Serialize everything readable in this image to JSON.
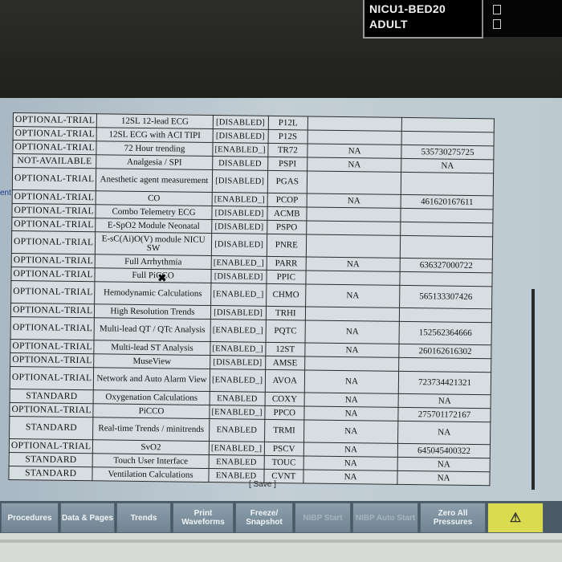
{
  "header": {
    "bed_name": "NICU1-BED20",
    "patient_type": "ADULT"
  },
  "edge_text": "ent",
  "options": [
    {
      "status": "OPTIONAL-TRIAL",
      "feature": "12SL 12-lead ECG",
      "state": "[DISABLED]",
      "code": "P12L",
      "license": "",
      "key": ""
    },
    {
      "status": "OPTIONAL-TRIAL",
      "feature": "12SL ECG with ACI TIPI",
      "state": "[DISABLED]",
      "code": "P12S",
      "license": "",
      "key": ""
    },
    {
      "status": "OPTIONAL-TRIAL",
      "feature": "72 Hour trending",
      "state": "[ENABLED_]",
      "code": "TR72",
      "license": "NA",
      "key": "535730275725"
    },
    {
      "status": "NOT-AVAILABLE",
      "feature": "Analgesia / SPI",
      "state": "DISABLED",
      "code": "PSPI",
      "license": "NA",
      "key": "NA"
    },
    {
      "status": "OPTIONAL-TRIAL",
      "feature": "Anesthetic agent measurement",
      "state": "[DISABLED]",
      "code": "PGAS",
      "license": "",
      "key": "",
      "tall": true
    },
    {
      "status": "OPTIONAL-TRIAL",
      "feature": "CO",
      "state": "[ENABLED_]",
      "code": "PCOP",
      "license": "NA",
      "key": "461620167611"
    },
    {
      "status": "OPTIONAL-TRIAL",
      "feature": "Combo Telemetry ECG",
      "state": "[DISABLED]",
      "code": "ACMB",
      "license": "",
      "key": ""
    },
    {
      "status": "OPTIONAL-TRIAL",
      "feature": "E-SpO2 Module Neonatal",
      "state": "[DISABLED]",
      "code": "PSPO",
      "license": "",
      "key": ""
    },
    {
      "status": "OPTIONAL-TRIAL",
      "feature": "E-sC(Ai)O(V) module NICU SW",
      "state": "[DISABLED]",
      "code": "PNRE",
      "license": "",
      "key": "",
      "tall": true
    },
    {
      "status": "OPTIONAL-TRIAL",
      "feature": "Full Arrhythmia",
      "state": "[ENABLED_]",
      "code": "PARR",
      "license": "NA",
      "key": "636327000722"
    },
    {
      "status": "OPTIONAL-TRIAL",
      "feature": "Full PiCCO",
      "state": "[DISABLED]",
      "code": "PPIC",
      "license": "",
      "key": ""
    },
    {
      "status": "OPTIONAL-TRIAL",
      "feature": "Hemodynamic Calculations",
      "state": "[ENABLED_]",
      "code": "CHMO",
      "license": "NA",
      "key": "565133307426",
      "tall": true
    },
    {
      "status": "OPTIONAL-TRIAL",
      "feature": "High Resolution Trends",
      "state": "[DISABLED]",
      "code": "TRHI",
      "license": "",
      "key": ""
    },
    {
      "status": "OPTIONAL-TRIAL",
      "feature": "Multi-lead QT / QTc Analysis",
      "state": "[ENABLED_]",
      "code": "PQTC",
      "license": "NA",
      "key": "152562364666",
      "tall": true
    },
    {
      "status": "OPTIONAL-TRIAL",
      "feature": "Multi-lead ST Analysis",
      "state": "[ENABLED_]",
      "code": "12ST",
      "license": "NA",
      "key": "260162616302"
    },
    {
      "status": "OPTIONAL-TRIAL",
      "feature": "MuseView",
      "state": "[DISABLED]",
      "code": "AMSE",
      "license": "",
      "key": ""
    },
    {
      "status": "OPTIONAL-TRIAL",
      "feature": "Network and Auto Alarm View",
      "state": "[ENABLED_]",
      "code": "AVOA",
      "license": "NA",
      "key": "723734421321",
      "tall": true
    },
    {
      "status": "STANDARD",
      "feature": "Oxygenation Calculations",
      "state": "ENABLED",
      "code": "COXY",
      "license": "NA",
      "key": "NA"
    },
    {
      "status": "OPTIONAL-TRIAL",
      "feature": "PiCCO",
      "state": "[ENABLED_]",
      "code": "PPCO",
      "license": "NA",
      "key": "275701172167"
    },
    {
      "status": "STANDARD",
      "feature": "Real-time Trends / minitrends",
      "state": "ENABLED",
      "code": "TRMI",
      "license": "NA",
      "key": "NA",
      "tall": true
    },
    {
      "status": "OPTIONAL-TRIAL",
      "feature": "SvO2",
      "state": "[ENABLED_]",
      "code": "PSCV",
      "license": "NA",
      "key": "645045400322"
    },
    {
      "status": "STANDARD",
      "feature": "Touch User Interface",
      "state": "ENABLED",
      "code": "TOUC",
      "license": "NA",
      "key": "NA"
    },
    {
      "status": "STANDARD",
      "feature": "Ventilation Calculations",
      "state": "ENABLED",
      "code": "CVNT",
      "license": "NA",
      "key": "NA"
    }
  ],
  "save_label": "[ Save ]",
  "softkeys": [
    {
      "label": "Procedures",
      "dim": false
    },
    {
      "label": "Data & Pages",
      "dim": false
    },
    {
      "label": "Trends",
      "dim": false
    },
    {
      "label": "Print Waveforms",
      "dim": false
    },
    {
      "label": "Freeze/ Snapshot",
      "dim": false
    },
    {
      "label": "NIBP Start",
      "dim": true
    },
    {
      "label": "NIBP Auto Start",
      "dim": true
    },
    {
      "label": "Zero All Pressures",
      "dim": false
    },
    {
      "label": "⚠",
      "dim": false,
      "alarm": true
    }
  ],
  "colors": {
    "screen_bg": "#c3ced6",
    "softkey_bg": "#7a8d9a",
    "alarm_key": "#dadb4e"
  }
}
